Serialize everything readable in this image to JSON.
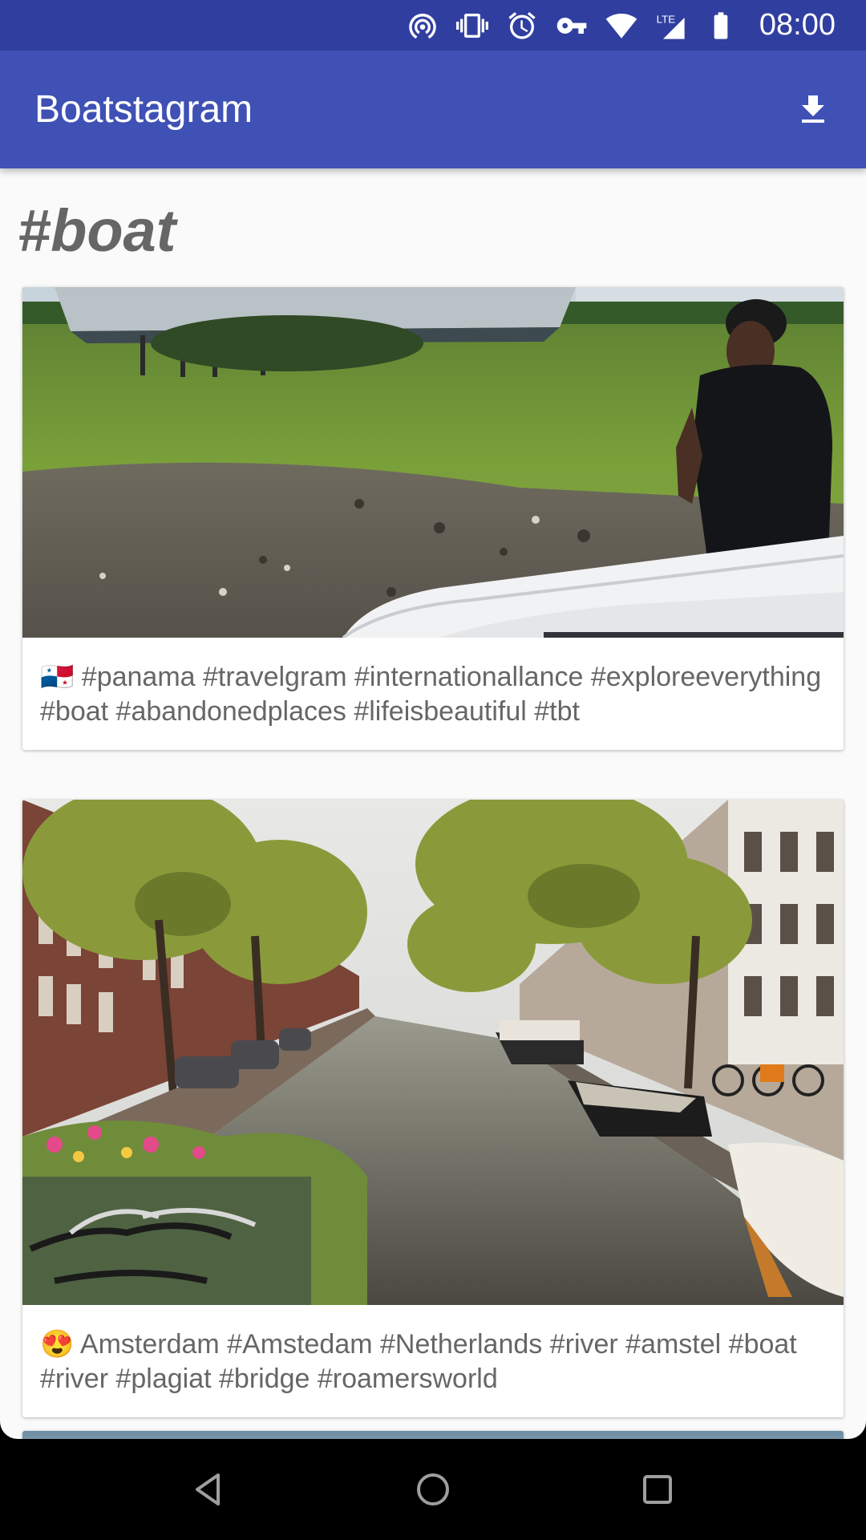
{
  "status_bar": {
    "time": "08:00",
    "icons": [
      "hotspot-icon",
      "vibrate-icon",
      "alarm-icon",
      "vpn-key-icon",
      "wifi-icon",
      "lte-signal-icon",
      "battery-icon"
    ],
    "lte_label": "LTE"
  },
  "app_bar": {
    "title": "Boatstagram",
    "action_icon": "download-icon"
  },
  "page": {
    "hashtag": "#boat"
  },
  "posts": [
    {
      "caption": "🇵🇦 #panama #travelgram #internationallance #exploreeverything #boat #abandonedplaces #lifeisbeautiful #tbt",
      "image": "grass-field-man-boat-photo"
    },
    {
      "caption": "😍 Amsterdam #Amstedam #Netherlands #river #amstel #boat #river #plagiat #bridge #roamersworld",
      "image": "amsterdam-canal-photo"
    },
    {
      "caption": "",
      "image": "partial-next-photo"
    }
  ],
  "nav_bar": {
    "buttons": [
      "back-icon",
      "home-icon",
      "recents-icon"
    ]
  },
  "colors": {
    "status_bar": "#303f9f",
    "app_bar": "#3f51b5",
    "background": "#fafafa",
    "text_secondary": "#666666"
  }
}
